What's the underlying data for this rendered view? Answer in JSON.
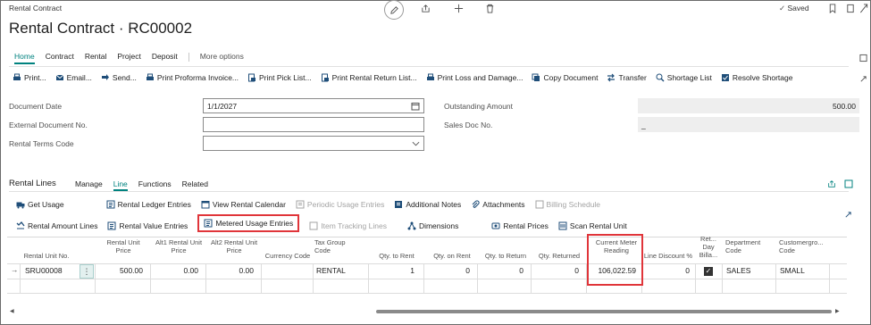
{
  "header": {
    "breadcrumb": "Rental Contract",
    "title": "Rental Contract · RC00002",
    "saved_label": "Saved"
  },
  "action_tabs": [
    "Home",
    "Contract",
    "Rental",
    "Project",
    "Deposit"
  ],
  "more_options": "More options",
  "actions": [
    "Print...",
    "Email...",
    "Send...",
    "Print Proforma Invoice...",
    "Print Pick List...",
    "Print Rental Return List...",
    "Print Loss and Damage...",
    "Copy Document",
    "Transfer",
    "Shortage List",
    "Resolve Shortage"
  ],
  "fields": {
    "document_date": {
      "label": "Document Date",
      "value": "1/1/2027"
    },
    "external_doc": {
      "label": "External Document No.",
      "value": ""
    },
    "rental_terms": {
      "label": "Rental Terms Code",
      "value": ""
    },
    "outstanding": {
      "label": "Outstanding Amount",
      "value": "500.00"
    },
    "sales_doc": {
      "label": "Sales Doc No.",
      "value": "_"
    }
  },
  "lines": {
    "title": "Rental Lines",
    "tabs": [
      "Manage",
      "Line",
      "Functions",
      "Related"
    ],
    "row1": [
      "Get Usage",
      "Rental Ledger Entries",
      "View Rental Calendar",
      "Periodic Usage Entries",
      "Additional Notes",
      "Attachments",
      "Billing Schedule"
    ],
    "row2": [
      "Rental Amount Lines",
      "Rental Value Entries",
      "Metered Usage Entries",
      "Item Tracking Lines",
      "Dimensions",
      "Rental Prices",
      "Scan Rental Unit"
    ],
    "columns": {
      "unit_no": "Rental Unit No.",
      "unit_price_1": "Rental Unit",
      "unit_price_2": "Price",
      "alt1_1": "Alt1 Rental Unit",
      "alt1_2": "Price",
      "alt2_1": "Alt2 Rental Unit",
      "alt2_2": "Price",
      "currency": "Currency Code",
      "taxgroup_1": "Tax Group",
      "taxgroup_2": "Code",
      "qty_rent": "Qty. to Rent",
      "qty_on_rent": "Qty. on Rent",
      "qty_return": "Qty. to Return",
      "qty_returned": "Qty. Returned",
      "meter_1": "Current Meter",
      "meter_2": "Reading",
      "discount": "Line Discount %",
      "dayb_1": "Ret...",
      "dayb_2": "Day",
      "dayb_3": "Billa...",
      "dept_1": "Department",
      "dept_2": "Code",
      "custgrp_1": "Customergro...",
      "custgrp_2": "Code"
    },
    "row": {
      "unit_no": "SRU00008",
      "unit_price": "500.00",
      "alt1": "0.00",
      "alt2": "0.00",
      "currency": "",
      "taxgroup": "RENTAL",
      "qty_rent": "1",
      "qty_on_rent": "0",
      "qty_return": "0",
      "qty_returned": "0",
      "meter": "106,022.59",
      "discount": "0",
      "dept": "SALES",
      "custgrp": "SMALL"
    }
  },
  "colors": {
    "accent": "#00827f",
    "highlight": "#e0353a"
  }
}
